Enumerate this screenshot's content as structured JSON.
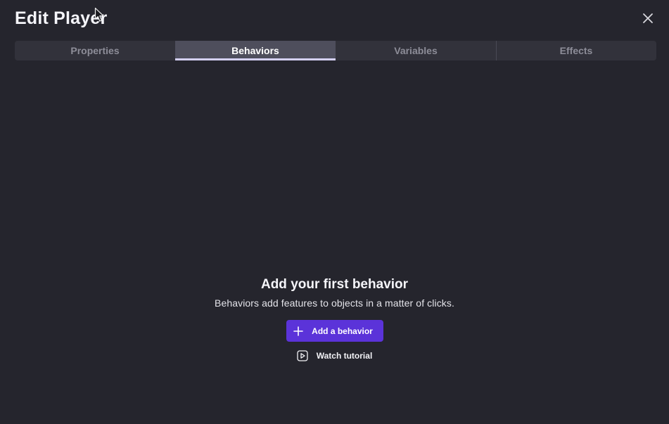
{
  "dialog": {
    "title": "Edit Player",
    "close_icon": "close-icon"
  },
  "tabs": [
    {
      "label": "Properties",
      "active": false
    },
    {
      "label": "Behaviors",
      "active": true
    },
    {
      "label": "Variables",
      "active": false
    },
    {
      "label": "Effects",
      "active": false
    }
  ],
  "empty_state": {
    "title": "Add your first behavior",
    "description": "Behaviors add features to objects in a matter of clicks.",
    "primary_button": {
      "label": "Add a behavior",
      "icon": "plus-icon"
    },
    "secondary_button": {
      "label": "Watch tutorial",
      "icon": "play-icon"
    }
  },
  "colors": {
    "background": "#25252d",
    "tab_bar": "#32323b",
    "tab_active": "#4e4e5c",
    "accent": "#5b33d9"
  }
}
